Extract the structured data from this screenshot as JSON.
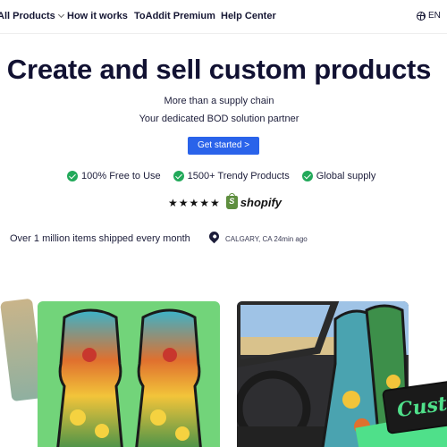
{
  "nav": {
    "all_products": "All Products",
    "how_it_works": "How it works",
    "premium": "ToAddit Premium",
    "help_center": "Help Center",
    "language": "EN"
  },
  "hero": {
    "headline": "Create and sell custom products",
    "subtitle_1": "More than a supply chain",
    "subtitle_2": "Your dedicated BOD solution partner",
    "cta_label": "Get started >"
  },
  "features": [
    "100% Free to Use",
    "1500+ Trendy Products",
    "Global supply"
  ],
  "rating": {
    "stars": "★★★★★",
    "platform": "shopify"
  },
  "social_proof": {
    "shipped": "Over 1 million items shipped every month",
    "location": "CALGARY, CA 24min ago"
  },
  "badge": {
    "text": "Custo"
  },
  "colors": {
    "accent": "#2a63ea",
    "check": "#22a95a",
    "product_bg": "#72d47a",
    "badge_green": "#4fe08a"
  }
}
